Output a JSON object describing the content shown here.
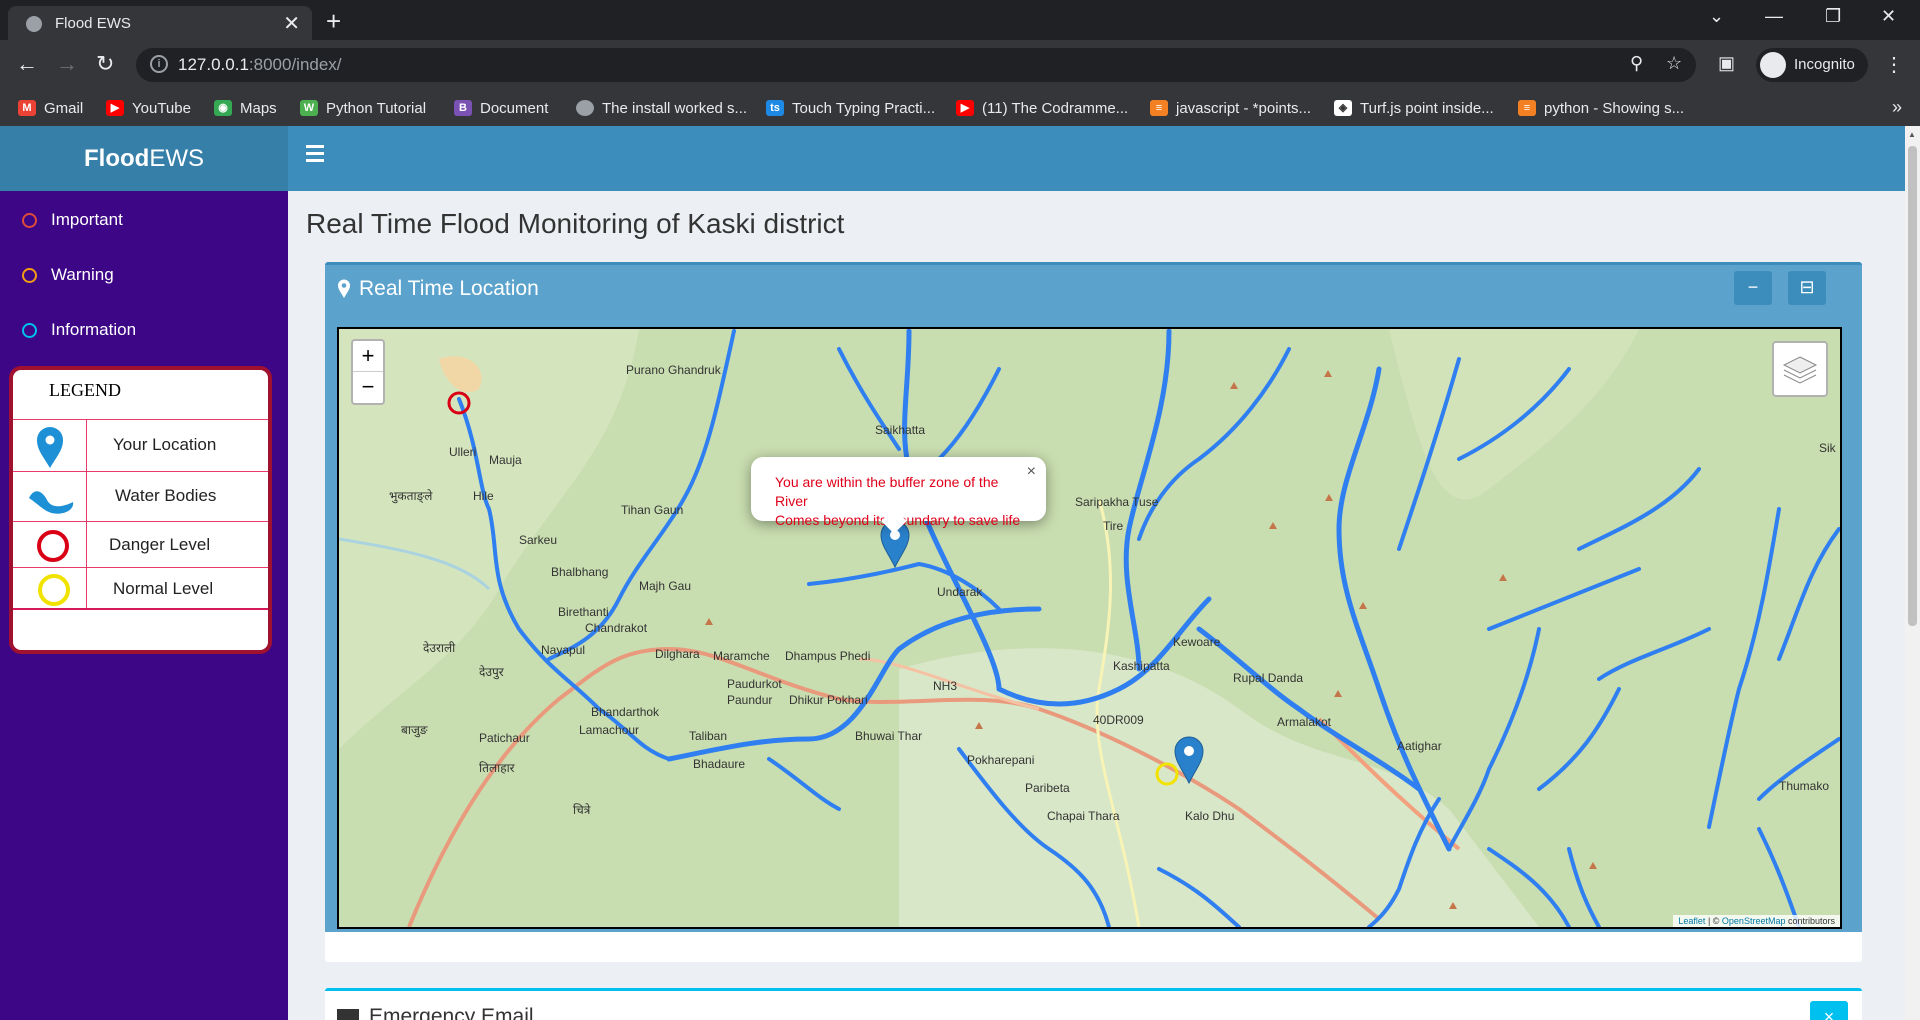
{
  "browser": {
    "tab_title": "Flood EWS",
    "tab_close": "✕",
    "new_tab": "+",
    "url_host": "127.0.0.1",
    "url_path": ":8000/index/",
    "profile": "Incognito",
    "bookmarks": [
      "Gmail",
      "YouTube",
      "Maps",
      "Python Tutorial",
      "Document",
      "The install worked s...",
      "Touch Typing Practi...",
      "(11) The Codramme...",
      "javascript - *points...",
      "Turf.js point inside...",
      "python - Showing s..."
    ],
    "bookmarks_more": "»"
  },
  "sidebar": {
    "logo_bold": "Flood",
    "logo_light": "EWS",
    "items": [
      {
        "label": "Important",
        "color": "#dd4b39"
      },
      {
        "label": "Warning",
        "color": "#f39c12"
      },
      {
        "label": "Information",
        "color": "#00c0ef"
      }
    ],
    "legend": {
      "title": "LEGEND",
      "rows": [
        "Your Location",
        "Water Bodies",
        "Danger Level",
        "Normal Level"
      ]
    }
  },
  "header": {
    "menu_icon": "hamburger-icon"
  },
  "page": {
    "title": "Real Time Flood Monitoring of Kaski district"
  },
  "map_box": {
    "title": "Real Time Location",
    "collapse_label": "−",
    "popup_line1": "You are within the buffer zone of the River",
    "popup_line2": "Comes beyond its boundary to save life",
    "popup_close": "×",
    "zoom_in": "+",
    "zoom_out": "−",
    "attribution_leaflet": "Leaflet",
    "attribution_sep": " | © ",
    "attribution_osm": "OpenStreetMap",
    "attribution_tail": " contributors",
    "place_labels": [
      "Purano Ghandruk",
      "Saikhatta",
      "Ulleri",
      "Mauja",
      "भुकताङ्ले",
      "Hile",
      "Tihan Gaun",
      "Sarkeu",
      "Bhalbhang",
      "Majh Gau",
      "Birethanti",
      "Chandrakot",
      "Nayapul",
      "Dilghara",
      "Maramche",
      "Dhampus Phedi",
      "Saripakha Tuse",
      "Kewoare",
      "Kashipatta",
      "Rupal Danda",
      "Armalakot",
      "Aatighar",
      "Paudurkot",
      "Paundur",
      "Dhikur Pokhari",
      "Bhandarthok",
      "Lamachour",
      "Taliban",
      "Bhuwai Thar",
      "Pokharepani",
      "Paribeta",
      "Patichaur",
      "तिलाहार",
      "बाजुङ",
      "देउराली",
      "देउपुर",
      "Bhadaure",
      "Thumako",
      "Sik",
      "Chapai Thara",
      "चित्रे",
      "Tire",
      "Undarak",
      "40DR009",
      "NH3",
      "Kalo Dhu"
    ]
  },
  "emergency_box": {
    "title": "Emergency Email",
    "close": "×"
  }
}
